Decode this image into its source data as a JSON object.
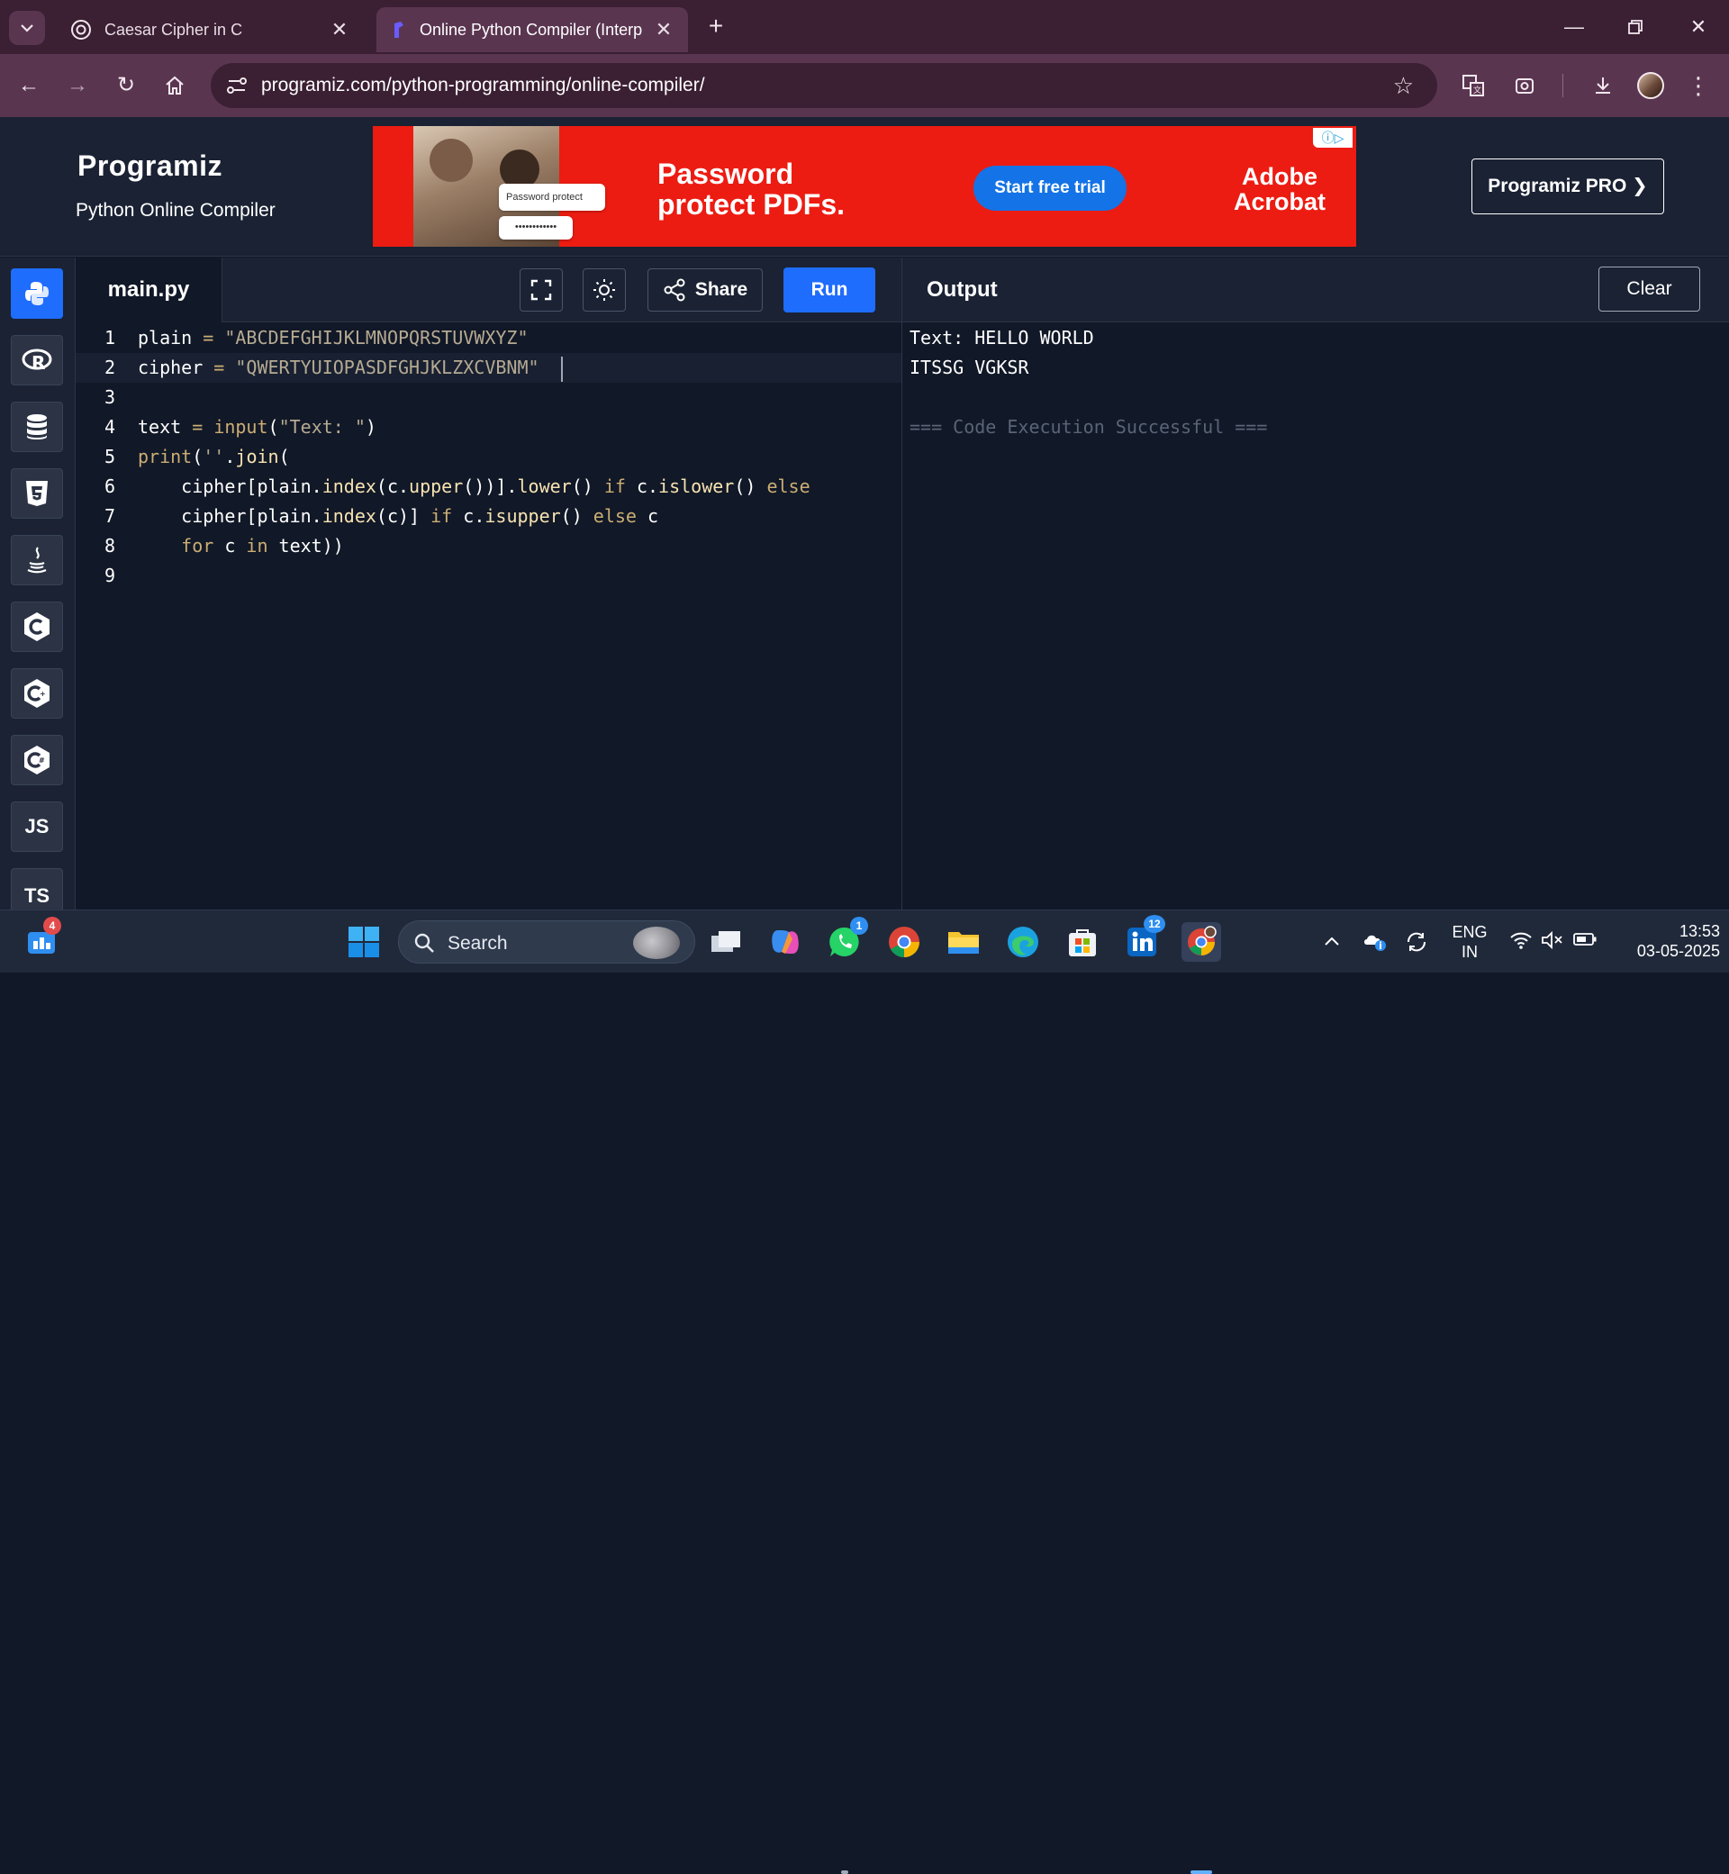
{
  "browser": {
    "tabs": [
      {
        "title": "Caesar Cipher in C",
        "active": false,
        "icon": "chatgpt-icon"
      },
      {
        "title": "Online Python Compiler (Interp",
        "active": true,
        "icon": "programiz-favicon"
      }
    ],
    "url": "programiz.com/python-programming/online-compiler/",
    "accent_color": "#5a3550"
  },
  "header": {
    "logo": "Programiz",
    "subtitle": "Python Online Compiler",
    "pro_button": "Programiz PRO ❯"
  },
  "ad": {
    "headline_line1": "Password",
    "headline_line2": "protect PDFs.",
    "cta": "Start free trial",
    "brand_line1": "Adobe",
    "brand_line2": "Acrobat",
    "pill_text": "Password protect",
    "pill_dots": "••••••••••••",
    "background_color": "#ec1c12"
  },
  "languages": [
    {
      "name": "python-icon",
      "label": "",
      "active": true
    },
    {
      "name": "r-icon",
      "label": "R",
      "active": false
    },
    {
      "name": "sql-icon",
      "label": "",
      "active": false
    },
    {
      "name": "html5-icon",
      "label": "5",
      "active": false
    },
    {
      "name": "java-icon",
      "label": "",
      "active": false
    },
    {
      "name": "c-icon",
      "label": "C",
      "active": false
    },
    {
      "name": "cpp-icon",
      "label": "C",
      "active": false
    },
    {
      "name": "csharp-icon",
      "label": "C",
      "active": false
    },
    {
      "name": "js-label",
      "label": "JS",
      "active": false
    },
    {
      "name": "ts-label",
      "label": "TS",
      "active": false
    }
  ],
  "editor": {
    "filename": "main.py",
    "share_label": "Share",
    "run_label": "Run",
    "run_color": "#1f6dfc",
    "lines": [
      {
        "num": "1",
        "tokens": [
          [
            "id",
            "plain "
          ],
          [
            "op",
            "="
          ],
          [
            "id",
            " "
          ],
          [
            "str",
            "\"ABCDEFGHIJKLMNOPQRSTUVWXYZ\""
          ]
        ]
      },
      {
        "num": "2",
        "tokens": [
          [
            "id",
            "cipher "
          ],
          [
            "op",
            "="
          ],
          [
            "id",
            " "
          ],
          [
            "str",
            "\"QWERTYUIOPASDFGHJKLZXCVBNM\""
          ]
        ]
      },
      {
        "num": "3",
        "tokens": []
      },
      {
        "num": "4",
        "tokens": [
          [
            "id",
            "text "
          ],
          [
            "op",
            "="
          ],
          [
            "id",
            " "
          ],
          [
            "kw",
            "input"
          ],
          [
            "id",
            "("
          ],
          [
            "str",
            "\"Text: \""
          ],
          [
            "id",
            ")"
          ]
        ]
      },
      {
        "num": "5",
        "tokens": [
          [
            "kw",
            "print"
          ],
          [
            "id",
            "("
          ],
          [
            "str",
            "''"
          ],
          [
            "id",
            "."
          ],
          [
            "fn",
            "join"
          ],
          [
            "id",
            "("
          ]
        ]
      },
      {
        "num": "6",
        "tokens": [
          [
            "id",
            "    cipher[plain."
          ],
          [
            "fn",
            "index"
          ],
          [
            "id",
            "(c."
          ],
          [
            "fn",
            "upper"
          ],
          [
            "id",
            "())]."
          ],
          [
            "fn",
            "lower"
          ],
          [
            "id",
            "() "
          ],
          [
            "kw",
            "if"
          ],
          [
            "id",
            " c."
          ],
          [
            "fn",
            "islower"
          ],
          [
            "id",
            "() "
          ],
          [
            "kw",
            "else"
          ]
        ]
      },
      {
        "num": "7",
        "tokens": [
          [
            "id",
            "    cipher[plain."
          ],
          [
            "fn",
            "index"
          ],
          [
            "id",
            "(c)] "
          ],
          [
            "kw",
            "if"
          ],
          [
            "id",
            " c."
          ],
          [
            "fn",
            "isupper"
          ],
          [
            "id",
            "() "
          ],
          [
            "kw",
            "else"
          ],
          [
            "id",
            " c"
          ]
        ]
      },
      {
        "num": "8",
        "tokens": [
          [
            "id",
            "    "
          ],
          [
            "kw",
            "for"
          ],
          [
            "id",
            " c "
          ],
          [
            "kw",
            "in"
          ],
          [
            "id",
            " text))"
          ]
        ]
      },
      {
        "num": "9",
        "tokens": []
      }
    ]
  },
  "output": {
    "title": "Output",
    "clear_label": "Clear",
    "lines": [
      {
        "text": "Text: HELLO WORLD",
        "dim": false
      },
      {
        "text": "ITSSG VGKSR",
        "dim": false
      },
      {
        "text": "",
        "dim": false
      },
      {
        "text": "=== Code Execution Successful ===",
        "dim": true
      }
    ]
  },
  "taskbar": {
    "search_label": "Search",
    "widgets_badge": "4",
    "whatsapp_badge": "1",
    "linkedin_badge": "12",
    "language_line1": "ENG",
    "language_line2": "IN",
    "time": "13:53",
    "date": "03-05-2025"
  }
}
